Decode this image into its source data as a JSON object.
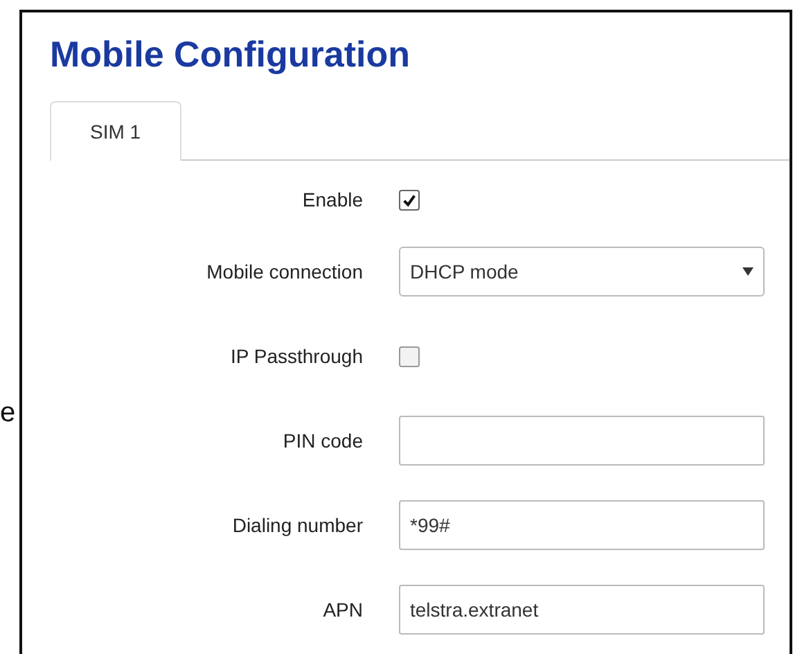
{
  "side_text": "e",
  "title": "Mobile Configuration",
  "tabs": [
    {
      "label": "SIM 1",
      "selected": true
    }
  ],
  "fields": [
    {
      "kind": "checkbox",
      "label": "Enable",
      "checked": true
    },
    {
      "kind": "select",
      "label": "Mobile connection",
      "value": "DHCP mode"
    },
    {
      "kind": "checkbox",
      "label": "IP Passthrough",
      "checked": false
    },
    {
      "kind": "text",
      "label": "PIN code"
    },
    {
      "kind": "text",
      "label": "Dialing number",
      "value": "*99#"
    },
    {
      "kind": "text",
      "label": "APN",
      "value": "telstra.extranet"
    }
  ]
}
